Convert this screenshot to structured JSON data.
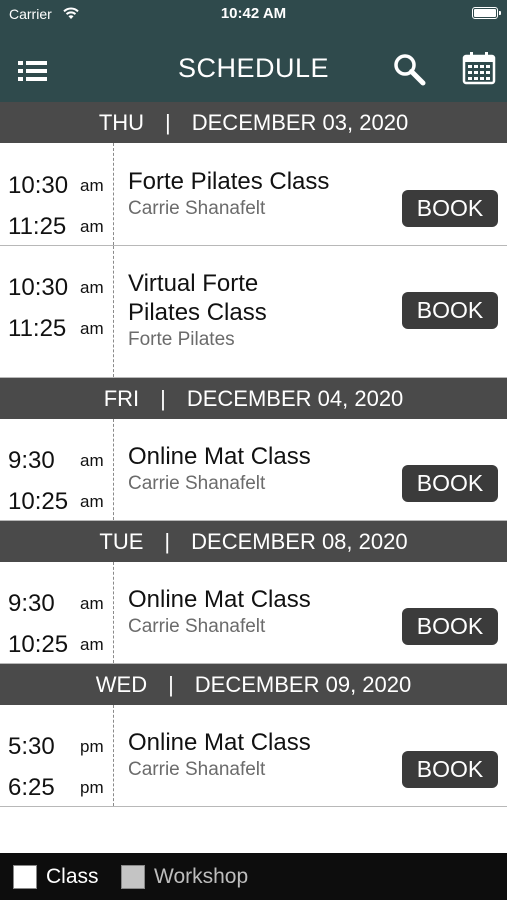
{
  "status": {
    "carrier": "Carrier",
    "time": "10:42 AM"
  },
  "header": {
    "title": "SCHEDULE"
  },
  "icons": {
    "menu": "menu-list-icon",
    "search": "search-icon",
    "calendar": "calendar-icon"
  },
  "colors": {
    "header_bg": "#2f4a4c",
    "day_header_bg": "#4a4a4a",
    "book_bg": "#3b3b3b",
    "legend_bg": "#0d0d0d",
    "class_swatch": "#ffffff",
    "workshop_swatch": "#c4c4c4"
  },
  "days": [
    {
      "weekday": "THU",
      "separator": "|",
      "date": "DECEMBER 03, 2020"
    },
    {
      "weekday": "FRI",
      "separator": "|",
      "date": "DECEMBER 04, 2020"
    },
    {
      "weekday": "TUE",
      "separator": "|",
      "date": "DECEMBER 08, 2020"
    },
    {
      "weekday": "WED",
      "separator": "|",
      "date": "DECEMBER 09, 2020"
    }
  ],
  "classes": [
    {
      "start": "10:30",
      "start_ampm": "am",
      "end": "11:25",
      "end_ampm": "am",
      "name": "Forte Pilates Class",
      "instructor": "Carrie Shanafelt",
      "action": "BOOK"
    },
    {
      "start": "10:30",
      "start_ampm": "am",
      "end": "11:25",
      "end_ampm": "am",
      "name_line1": "Virtual Forte",
      "name_line2": "Pilates Class",
      "instructor": "Forte Pilates",
      "action": "BOOK"
    },
    {
      "start": "9:30",
      "start_ampm": "am",
      "end": "10:25",
      "end_ampm": "am",
      "name": "Online Mat Class",
      "instructor": "Carrie Shanafelt",
      "action": "BOOK"
    },
    {
      "start": "9:30",
      "start_ampm": "am",
      "end": "10:25",
      "end_ampm": "am",
      "name": "Online Mat Class",
      "instructor": "Carrie Shanafelt",
      "action": "BOOK"
    },
    {
      "start": "5:30",
      "start_ampm": "pm",
      "end": "6:25",
      "end_ampm": "pm",
      "name": "Online Mat Class",
      "instructor": "Carrie Shanafelt",
      "action": "BOOK"
    }
  ],
  "legend": {
    "class_label": "Class",
    "workshop_label": "Workshop"
  }
}
